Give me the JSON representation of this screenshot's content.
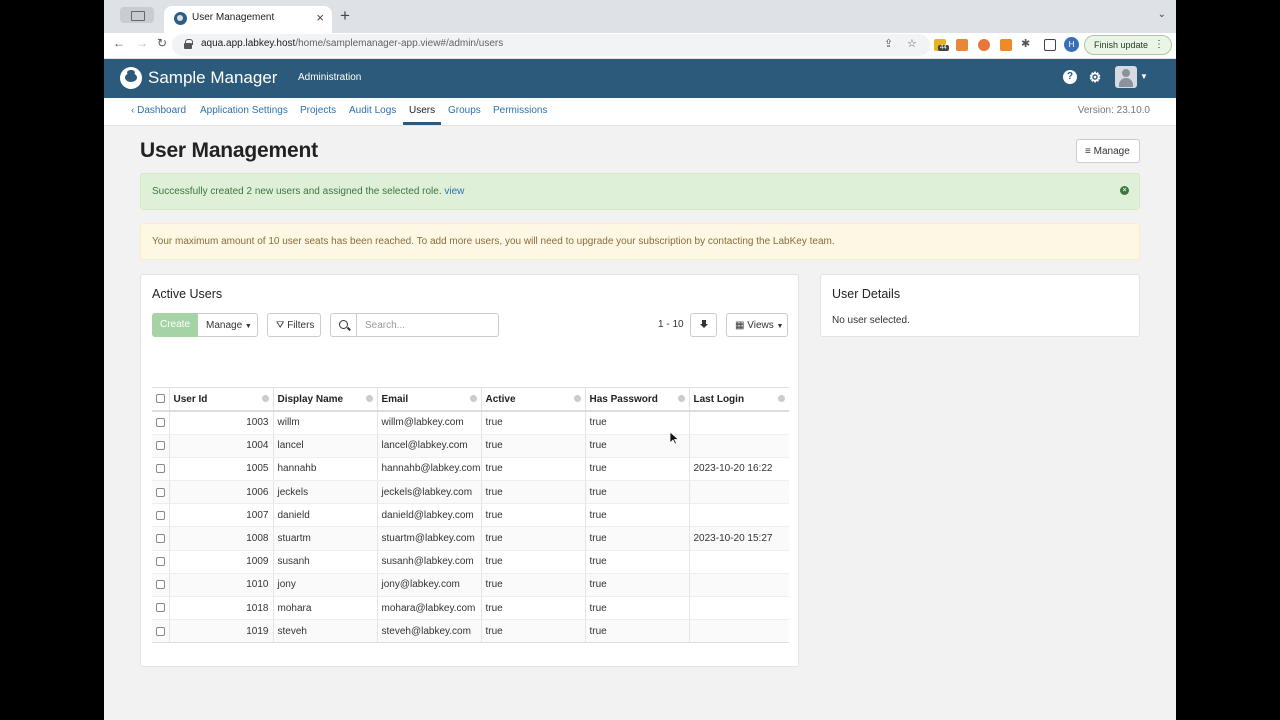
{
  "browser": {
    "tab_title": "User Management",
    "url_host": "aqua.app.labkey.host",
    "url_path": "/home/samplemanager-app.view#/admin/users",
    "extension_badge": "44",
    "profile_initial": "H",
    "finish_update_label": "Finish update"
  },
  "header": {
    "app_name": "Sample Manager",
    "section": "Administration"
  },
  "subnav": {
    "items": [
      {
        "label": "Dashboard"
      },
      {
        "label": "Application Settings"
      },
      {
        "label": "Projects"
      },
      {
        "label": "Audit Logs"
      },
      {
        "label": "Users"
      },
      {
        "label": "Groups"
      },
      {
        "label": "Permissions"
      }
    ],
    "active": "Users",
    "version": "Version: 23.10.0"
  },
  "page": {
    "title": "User Management",
    "manage_label": "Manage"
  },
  "alerts": {
    "success_text": "Successfully created 2 new users and assigned the selected role.",
    "success_link": "view",
    "warning_text": "Your maximum amount of 10 user seats has been reached. To add more users, you will need to upgrade your subscription by contacting the LabKey team."
  },
  "active_users": {
    "title": "Active Users",
    "create_label": "Create",
    "manage_label": "Manage",
    "filters_label": "Filters",
    "search_placeholder": "Search...",
    "pagination": "1 - 10",
    "views_label": "Views",
    "columns": [
      "User Id",
      "Display Name",
      "Email",
      "Active",
      "Has Password",
      "Last Login"
    ],
    "rows": [
      {
        "id": "1003",
        "name": "willm",
        "email": "willm@labkey.com",
        "active": "true",
        "has_password": "true",
        "last_login": ""
      },
      {
        "id": "1004",
        "name": "lancel",
        "email": "lancel@labkey.com",
        "active": "true",
        "has_password": "true",
        "last_login": ""
      },
      {
        "id": "1005",
        "name": "hannahb",
        "email": "hannahb@labkey.com",
        "active": "true",
        "has_password": "true",
        "last_login": "2023-10-20 16:22"
      },
      {
        "id": "1006",
        "name": "jeckels",
        "email": "jeckels@labkey.com",
        "active": "true",
        "has_password": "true",
        "last_login": ""
      },
      {
        "id": "1007",
        "name": "danield",
        "email": "danield@labkey.com",
        "active": "true",
        "has_password": "true",
        "last_login": ""
      },
      {
        "id": "1008",
        "name": "stuartm",
        "email": "stuartm@labkey.com",
        "active": "true",
        "has_password": "true",
        "last_login": "2023-10-20 15:27"
      },
      {
        "id": "1009",
        "name": "susanh",
        "email": "susanh@labkey.com",
        "active": "true",
        "has_password": "true",
        "last_login": ""
      },
      {
        "id": "1010",
        "name": "jony",
        "email": "jony@labkey.com",
        "active": "true",
        "has_password": "true",
        "last_login": ""
      },
      {
        "id": "1018",
        "name": "mohara",
        "email": "mohara@labkey.com",
        "active": "true",
        "has_password": "true",
        "last_login": ""
      },
      {
        "id": "1019",
        "name": "steveh",
        "email": "steveh@labkey.com",
        "active": "true",
        "has_password": "true",
        "last_login": ""
      }
    ]
  },
  "user_details": {
    "title": "User Details",
    "empty_text": "No user selected."
  },
  "colors": {
    "header_bg": "#2c5a7b",
    "link": "#3071a9",
    "success_bg": "#dff0d8",
    "warning_bg": "#fcf8e3"
  }
}
